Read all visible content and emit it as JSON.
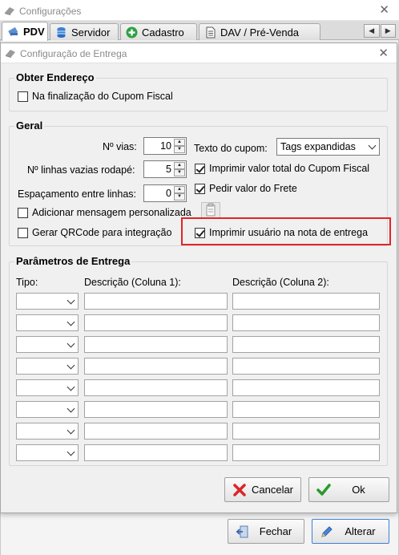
{
  "window": {
    "title": "Configurações"
  },
  "tabs": [
    {
      "label": "PDV"
    },
    {
      "label": "Servidor"
    },
    {
      "label": "Cadastro"
    },
    {
      "label": "DAV / Pré-Venda"
    }
  ],
  "dialog": {
    "title": "Configuração de Entrega",
    "obter_endereco": {
      "legend": "Obter Endereço",
      "na_finalizacao": {
        "label": "Na finalização do Cupom Fiscal",
        "checked": false
      }
    },
    "geral": {
      "legend": "Geral",
      "num_vias": {
        "label": "Nº vias:",
        "value": "10"
      },
      "linhas_vazias": {
        "label": "Nº linhas vazias rodapé:",
        "value": "5"
      },
      "espacamento": {
        "label": "Espaçamento entre linhas:",
        "value": "0"
      },
      "texto_cupom": {
        "label": "Texto do cupom:",
        "value": "Tags expandidas"
      },
      "imprimir_valor_total": {
        "label": "Imprimir valor total do Cupom Fiscal",
        "checked": true
      },
      "pedir_valor_frete": {
        "label": "Pedir valor do Frete",
        "checked": true
      },
      "adicionar_mensagem": {
        "label": "Adicionar mensagem personalizada",
        "checked": false
      },
      "gerar_qrcode": {
        "label": "Gerar QRCode para integração",
        "checked": false
      },
      "imprimir_usuario": {
        "label": "Imprimir usuário na nota de entrega",
        "checked": true
      }
    },
    "parametros": {
      "legend": "Parâmetros de Entrega",
      "col_tipo": "Tipo:",
      "col_desc1": "Descrição (Coluna 1):",
      "col_desc2": "Descrição (Coluna 2):",
      "rows": [
        {
          "tipo": "",
          "desc1": "",
          "desc2": ""
        },
        {
          "tipo": "",
          "desc1": "",
          "desc2": ""
        },
        {
          "tipo": "",
          "desc1": "",
          "desc2": ""
        },
        {
          "tipo": "",
          "desc1": "",
          "desc2": ""
        },
        {
          "tipo": "",
          "desc1": "",
          "desc2": ""
        },
        {
          "tipo": "",
          "desc1": "",
          "desc2": ""
        },
        {
          "tipo": "",
          "desc1": "",
          "desc2": ""
        },
        {
          "tipo": "",
          "desc1": "",
          "desc2": ""
        }
      ]
    },
    "buttons": {
      "cancelar": "Cancelar",
      "ok": "Ok"
    }
  },
  "footer": {
    "fechar": "Fechar",
    "alterar": "Alterar"
  },
  "colors": {
    "highlight": "#e3232b",
    "cancel_icon": "#d9262b",
    "ok_icon": "#2a9a2a"
  }
}
